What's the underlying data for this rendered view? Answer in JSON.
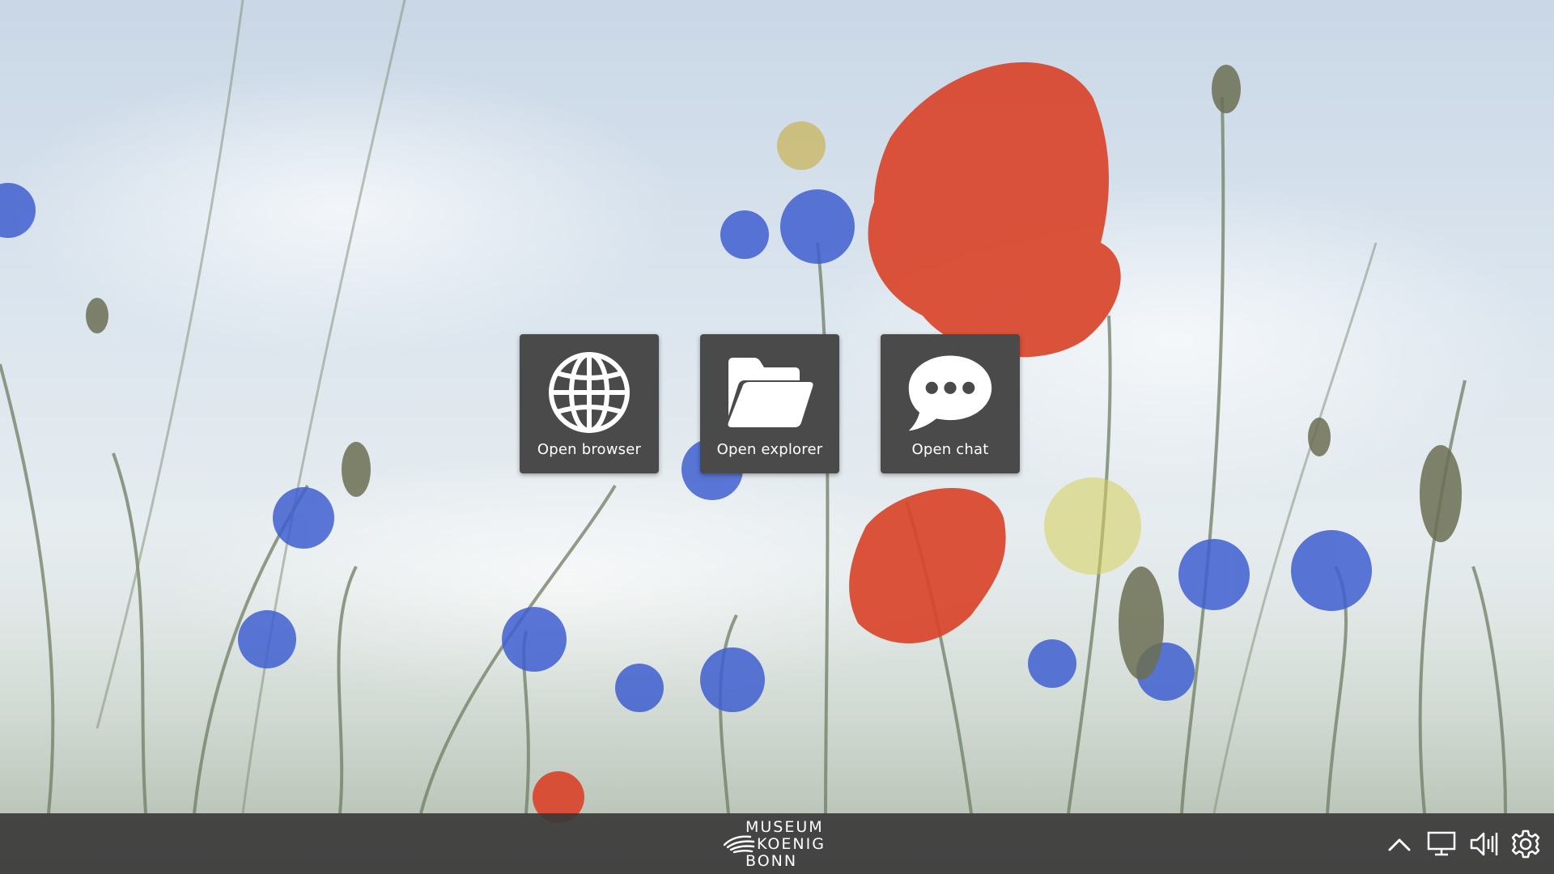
{
  "desktop": {
    "launchers": [
      {
        "label": "Open browser",
        "icon": "globe-icon"
      },
      {
        "label": "Open explorer",
        "icon": "folder-icon"
      },
      {
        "label": "Open chat",
        "icon": "chat-bubble-icon"
      }
    ]
  },
  "taskbar": {
    "logo": {
      "line1": "MUSEUM",
      "line2": "KOENIG",
      "line3": "BONN"
    },
    "tray_icons": [
      "chevron-up-icon",
      "monitor-icon",
      "speaker-icon",
      "gear-icon"
    ]
  },
  "colors": {
    "launcher_bg": "#4a4a4a",
    "taskbar_bg": "#3a3a3a",
    "icon_white": "#ffffff",
    "poppy_red": "#d9442a",
    "cornflower_blue": "#3f5fd0"
  }
}
